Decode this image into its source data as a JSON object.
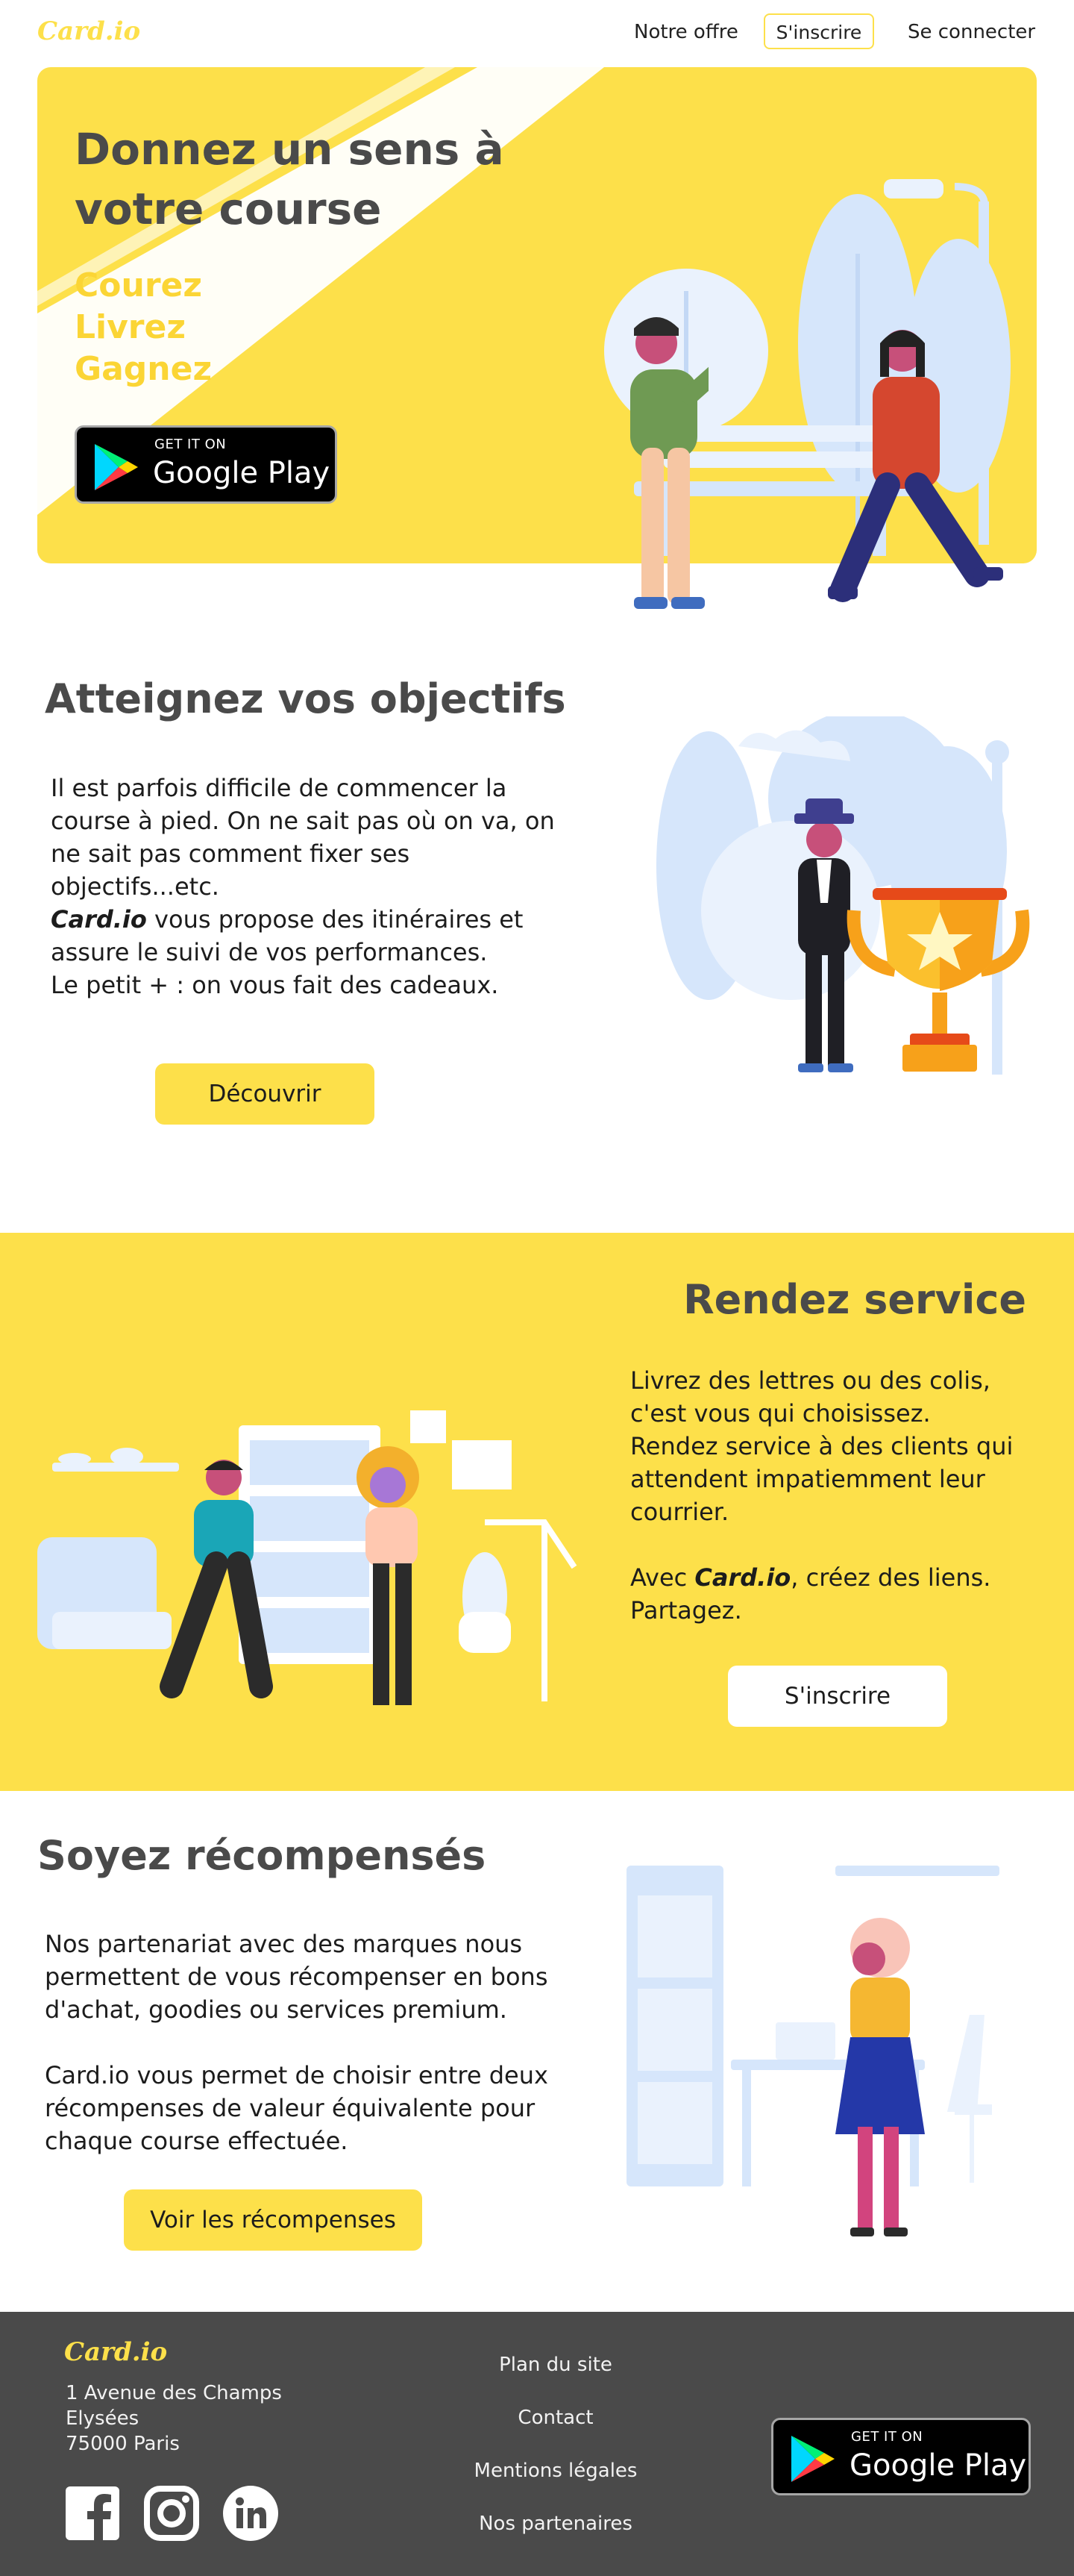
{
  "header": {
    "logo": "Card.io",
    "nav_offer": "Notre offre",
    "nav_signup": "S'inscrire",
    "nav_login": "Se connecter"
  },
  "hero": {
    "title": "Donnez un sens à votre course",
    "slogans": [
      "Courez",
      "Livrez",
      "Gagnez"
    ],
    "badge_small": "GET IT ON",
    "badge_big": "Google Play"
  },
  "objectives": {
    "title": "Atteignez vos objectifs",
    "para1": "Il est parfois difficile de commencer la course à pied. On ne sait pas où on va, on ne sait pas comment fixer ses objectifs...etc.",
    "brand": "Card.io",
    "para2_rest": " vous propose des itinéraires et assure le suivi de vos performances.",
    "para3": "Le petit + : on vous fait des cadeaux.",
    "button": "Découvrir"
  },
  "service": {
    "title": "Rendez service",
    "para1": "Livrez des lettres ou des colis, c'est vous qui choisissez.",
    "para2": "Rendez service à des clients qui attendent impatiemment leur courrier.",
    "para3_start": "Avec ",
    "brand": "Card.io",
    "para3_end": ", créez des liens.",
    "para4": "Partagez.",
    "button": "S'inscrire"
  },
  "rewards": {
    "title": "Soyez récompensés",
    "para1": "Nos partenariat avec des marques nous permettent de vous récompenser en bons d'achat, goodies ou services premium.",
    "para2": "Card.io vous permet de choisir entre deux récompenses de valeur équivalente pour chaque course effectuée.",
    "button": "Voir les récompenses"
  },
  "footer": {
    "logo": "Card.io",
    "address": "1 Avenue des Champs\nElysées\n75000 Paris",
    "links": [
      "Plan du site",
      "Contact",
      "Mentions légales",
      "Nos partenaires"
    ],
    "badge_small": "GET IT ON",
    "badge_big": "Google Play",
    "social": [
      "facebook-icon",
      "instagram-icon",
      "linkedin-icon"
    ]
  },
  "colors": {
    "accent_yellow": "#fde04a",
    "dark_gray": "#4a4a4a",
    "light_blue": "#d6e6fb"
  }
}
